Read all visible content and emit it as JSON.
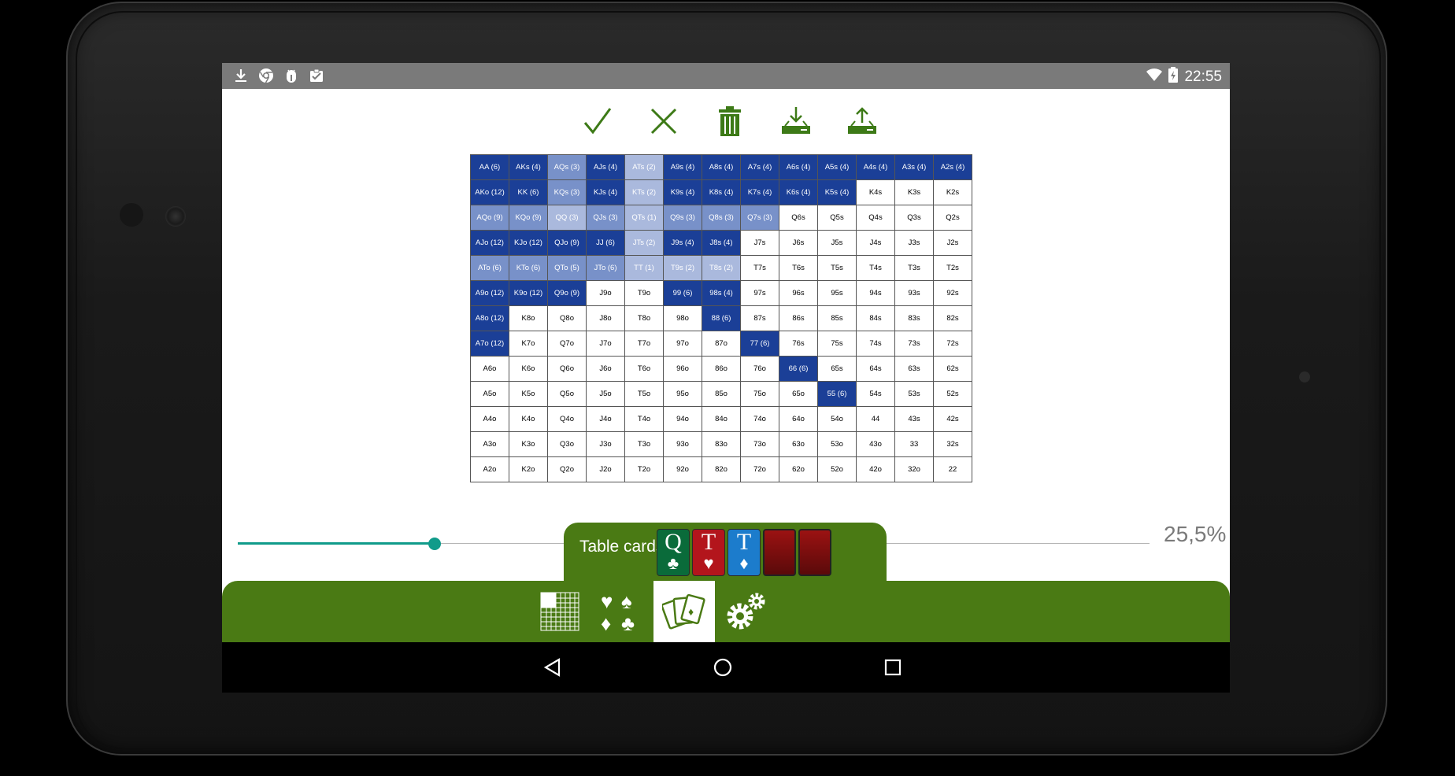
{
  "status_bar": {
    "time": "22:55",
    "left_icons": [
      "download-icon",
      "chrome-icon",
      "android-debug-icon",
      "clipboard-check-icon"
    ],
    "right_icons": [
      "wifi-icon",
      "battery-charging-icon"
    ]
  },
  "toolbar": {
    "buttons": [
      "confirm-icon",
      "cancel-icon",
      "delete-icon",
      "import-icon",
      "export-icon"
    ]
  },
  "range_grid": {
    "rows": [
      [
        [
          "AA (6)",
          4
        ],
        [
          "AKs (4)",
          4
        ],
        [
          "AQs (3)",
          2
        ],
        [
          "AJs (4)",
          4
        ],
        [
          "ATs (2)",
          1
        ],
        [
          "A9s (4)",
          4
        ],
        [
          "A8s (4)",
          4
        ],
        [
          "A7s (4)",
          4
        ],
        [
          "A6s (4)",
          4
        ],
        [
          "A5s (4)",
          4
        ],
        [
          "A4s (4)",
          4
        ],
        [
          "A3s (4)",
          4
        ],
        [
          "A2s (4)",
          4
        ]
      ],
      [
        [
          "AKo (12)",
          4
        ],
        [
          "KK (6)",
          4
        ],
        [
          "KQs (3)",
          2
        ],
        [
          "KJs (4)",
          4
        ],
        [
          "KTs (2)",
          1
        ],
        [
          "K9s (4)",
          4
        ],
        [
          "K8s (4)",
          4
        ],
        [
          "K7s (4)",
          4
        ],
        [
          "K6s (4)",
          4
        ],
        [
          "K5s (4)",
          4
        ],
        [
          "K4s",
          0
        ],
        [
          "K3s",
          0
        ],
        [
          "K2s",
          0
        ]
      ],
      [
        [
          "AQo (9)",
          2
        ],
        [
          "KQo (9)",
          2
        ],
        [
          "QQ (3)",
          1
        ],
        [
          "QJs (3)",
          2
        ],
        [
          "QTs (1)",
          1
        ],
        [
          "Q9s (3)",
          2
        ],
        [
          "Q8s (3)",
          2
        ],
        [
          "Q7s (3)",
          2
        ],
        [
          "Q6s",
          0
        ],
        [
          "Q5s",
          0
        ],
        [
          "Q4s",
          0
        ],
        [
          "Q3s",
          0
        ],
        [
          "Q2s",
          0
        ]
      ],
      [
        [
          "AJo (12)",
          4
        ],
        [
          "KJo (12)",
          4
        ],
        [
          "QJo (9)",
          4
        ],
        [
          "JJ (6)",
          4
        ],
        [
          "JTs (2)",
          1
        ],
        [
          "J9s (4)",
          4
        ],
        [
          "J8s (4)",
          4
        ],
        [
          "J7s",
          0
        ],
        [
          "J6s",
          0
        ],
        [
          "J5s",
          0
        ],
        [
          "J4s",
          0
        ],
        [
          "J3s",
          0
        ],
        [
          "J2s",
          0
        ]
      ],
      [
        [
          "ATo (6)",
          2
        ],
        [
          "KTo (6)",
          2
        ],
        [
          "QTo (5)",
          2
        ],
        [
          "JTo (6)",
          2
        ],
        [
          "TT (1)",
          1
        ],
        [
          "T9s (2)",
          1
        ],
        [
          "T8s (2)",
          1
        ],
        [
          "T7s",
          0
        ],
        [
          "T6s",
          0
        ],
        [
          "T5s",
          0
        ],
        [
          "T4s",
          0
        ],
        [
          "T3s",
          0
        ],
        [
          "T2s",
          0
        ]
      ],
      [
        [
          "A9o (12)",
          4
        ],
        [
          "K9o (12)",
          4
        ],
        [
          "Q9o (9)",
          4
        ],
        [
          "J9o",
          0
        ],
        [
          "T9o",
          0
        ],
        [
          "99 (6)",
          4
        ],
        [
          "98s (4)",
          4
        ],
        [
          "97s",
          0
        ],
        [
          "96s",
          0
        ],
        [
          "95s",
          0
        ],
        [
          "94s",
          0
        ],
        [
          "93s",
          0
        ],
        [
          "92s",
          0
        ]
      ],
      [
        [
          "A8o (12)",
          4
        ],
        [
          "K8o",
          0
        ],
        [
          "Q8o",
          0
        ],
        [
          "J8o",
          0
        ],
        [
          "T8o",
          0
        ],
        [
          "98o",
          0
        ],
        [
          "88 (6)",
          4
        ],
        [
          "87s",
          0
        ],
        [
          "86s",
          0
        ],
        [
          "85s",
          0
        ],
        [
          "84s",
          0
        ],
        [
          "83s",
          0
        ],
        [
          "82s",
          0
        ]
      ],
      [
        [
          "A7o (12)",
          4
        ],
        [
          "K7o",
          0
        ],
        [
          "Q7o",
          0
        ],
        [
          "J7o",
          0
        ],
        [
          "T7o",
          0
        ],
        [
          "97o",
          0
        ],
        [
          "87o",
          0
        ],
        [
          "77 (6)",
          4
        ],
        [
          "76s",
          0
        ],
        [
          "75s",
          0
        ],
        [
          "74s",
          0
        ],
        [
          "73s",
          0
        ],
        [
          "72s",
          0
        ]
      ],
      [
        [
          "A6o",
          0
        ],
        [
          "K6o",
          0
        ],
        [
          "Q6o",
          0
        ],
        [
          "J6o",
          0
        ],
        [
          "T6o",
          0
        ],
        [
          "96o",
          0
        ],
        [
          "86o",
          0
        ],
        [
          "76o",
          0
        ],
        [
          "66 (6)",
          4
        ],
        [
          "65s",
          0
        ],
        [
          "64s",
          0
        ],
        [
          "63s",
          0
        ],
        [
          "62s",
          0
        ]
      ],
      [
        [
          "A5o",
          0
        ],
        [
          "K5o",
          0
        ],
        [
          "Q5o",
          0
        ],
        [
          "J5o",
          0
        ],
        [
          "T5o",
          0
        ],
        [
          "95o",
          0
        ],
        [
          "85o",
          0
        ],
        [
          "75o",
          0
        ],
        [
          "65o",
          0
        ],
        [
          "55 (6)",
          4
        ],
        [
          "54s",
          0
        ],
        [
          "53s",
          0
        ],
        [
          "52s",
          0
        ]
      ],
      [
        [
          "A4o",
          0
        ],
        [
          "K4o",
          0
        ],
        [
          "Q4o",
          0
        ],
        [
          "J4o",
          0
        ],
        [
          "T4o",
          0
        ],
        [
          "94o",
          0
        ],
        [
          "84o",
          0
        ],
        [
          "74o",
          0
        ],
        [
          "64o",
          0
        ],
        [
          "54o",
          0
        ],
        [
          "44",
          0
        ],
        [
          "43s",
          0
        ],
        [
          "42s",
          0
        ]
      ],
      [
        [
          "A3o",
          0
        ],
        [
          "K3o",
          0
        ],
        [
          "Q3o",
          0
        ],
        [
          "J3o",
          0
        ],
        [
          "T3o",
          0
        ],
        [
          "93o",
          0
        ],
        [
          "83o",
          0
        ],
        [
          "73o",
          0
        ],
        [
          "63o",
          0
        ],
        [
          "53o",
          0
        ],
        [
          "43o",
          0
        ],
        [
          "33",
          0
        ],
        [
          "32s",
          0
        ]
      ],
      [
        [
          "A2o",
          0
        ],
        [
          "K2o",
          0
        ],
        [
          "Q2o",
          0
        ],
        [
          "J2o",
          0
        ],
        [
          "T2o",
          0
        ],
        [
          "92o",
          0
        ],
        [
          "82o",
          0
        ],
        [
          "72o",
          0
        ],
        [
          "62o",
          0
        ],
        [
          "52o",
          0
        ],
        [
          "42o",
          0
        ],
        [
          "32o",
          0
        ],
        [
          "22",
          0
        ]
      ]
    ]
  },
  "slider": {
    "fraction": 0.255,
    "value_text": "25,5%",
    "color": "#109b8a"
  },
  "table_cards": {
    "label": "Table cards",
    "cards": [
      {
        "rank": "Q",
        "suit": "♣",
        "color": "#0a6b3a",
        "face": true
      },
      {
        "rank": "T",
        "suit": "♥",
        "color": "#b3151c",
        "face": true
      },
      {
        "rank": "T",
        "suit": "♦",
        "color": "#1c7ccc",
        "face": true
      },
      {
        "face": false
      },
      {
        "face": false
      }
    ]
  },
  "bottom_nav": {
    "tabs": [
      "range-grid-icon",
      "suits-icon",
      "cards-icon",
      "settings-icon"
    ],
    "active_index": 2,
    "color": "#4a7a14"
  },
  "system_nav": [
    "back-icon",
    "home-icon",
    "recents-icon"
  ]
}
